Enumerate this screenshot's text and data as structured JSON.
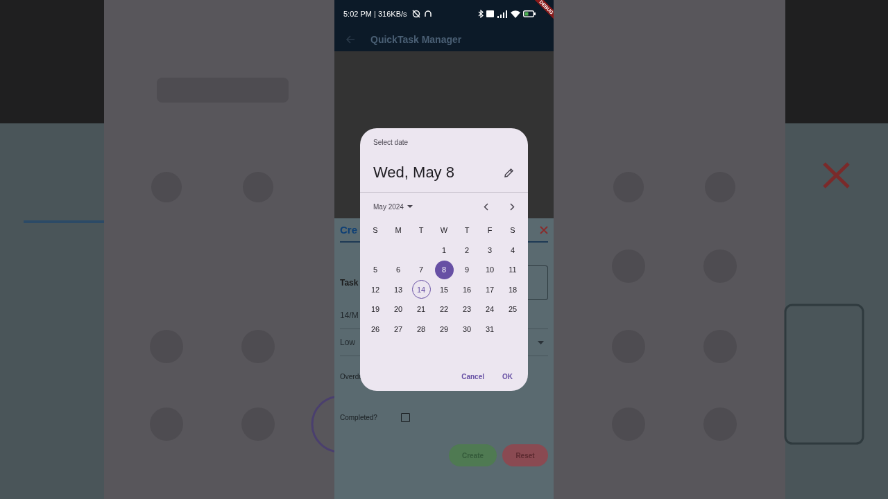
{
  "status_bar": {
    "time": "5:02 PM | 316KB/s",
    "debug_banner": "DEBUG"
  },
  "app_bar": {
    "title": "QuickTask Manager"
  },
  "form": {
    "title": "Cre",
    "task_label": "Task",
    "date_value": "14/M",
    "priority_value": "Low",
    "overdue_label": "Overdu",
    "completed_label": "Completed?",
    "completed_checked": false,
    "buttons": [
      {
        "label": "Create",
        "kind": "create"
      },
      {
        "label": "Reset",
        "kind": "reset"
      }
    ]
  },
  "date_picker": {
    "header": "Select date",
    "selected_date": "Wed, May 8",
    "month": "May 2024",
    "weekdays": [
      "S",
      "M",
      "T",
      "W",
      "T",
      "F",
      "S"
    ],
    "weeks": [
      [
        {
          "label": "1",
          "selected": false,
          "today": false
        },
        {
          "label": "2",
          "selected": false,
          "today": false
        },
        {
          "label": "3",
          "selected": false,
          "today": false
        },
        {
          "label": "4",
          "selected": false,
          "today": false
        }
      ],
      [
        {
          "label": "5",
          "selected": false,
          "today": false
        },
        {
          "label": "6",
          "selected": false,
          "today": false
        },
        {
          "label": "7",
          "selected": false,
          "today": false
        },
        {
          "label": "8",
          "selected": true,
          "today": false
        },
        {
          "label": "9",
          "selected": false,
          "today": false
        },
        {
          "label": "10",
          "selected": false,
          "today": false
        },
        {
          "label": "11",
          "selected": false,
          "today": false
        }
      ],
      [
        {
          "label": "12",
          "selected": false,
          "today": false
        },
        {
          "label": "13",
          "selected": false,
          "today": false
        },
        {
          "label": "14",
          "selected": false,
          "today": true
        },
        {
          "label": "15",
          "selected": false,
          "today": false
        },
        {
          "label": "16",
          "selected": false,
          "today": false
        },
        {
          "label": "17",
          "selected": false,
          "today": false
        },
        {
          "label": "18",
          "selected": false,
          "today": false
        }
      ],
      [
        {
          "label": "19",
          "selected": false,
          "today": false
        },
        {
          "label": "20",
          "selected": false,
          "today": false
        },
        {
          "label": "21",
          "selected": false,
          "today": false
        },
        {
          "label": "22",
          "selected": false,
          "today": false
        },
        {
          "label": "23",
          "selected": false,
          "today": false
        },
        {
          "label": "24",
          "selected": false,
          "today": false
        },
        {
          "label": "25",
          "selected": false,
          "today": false
        }
      ],
      [
        {
          "label": "26",
          "selected": false,
          "today": false
        },
        {
          "label": "27",
          "selected": false,
          "today": false
        },
        {
          "label": "28",
          "selected": false,
          "today": false
        },
        {
          "label": "29",
          "selected": false,
          "today": false
        },
        {
          "label": "30",
          "selected": false,
          "today": false
        },
        {
          "label": "31",
          "selected": false,
          "today": false
        }
      ]
    ],
    "actions": [
      {
        "label": "Cancel"
      },
      {
        "label": "OK"
      }
    ]
  }
}
